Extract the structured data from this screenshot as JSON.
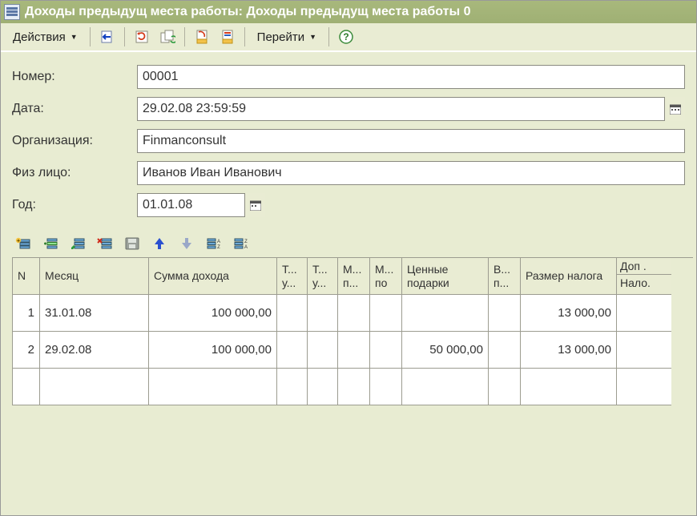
{
  "window": {
    "title": "Доходы предыдущ места работы: Доходы предыдущ места работы 0"
  },
  "toolbar": {
    "actions_label": "Действия",
    "goto_label": "Перейти"
  },
  "form": {
    "number_label": "Номер:",
    "number_value": "00001",
    "date_label": "Дата:",
    "date_value": "29.02.08 23:59:59",
    "org_label": "Организация:",
    "org_value": "Finmanconsult",
    "person_label": "Физ лицо:",
    "person_value": "Иванов Иван Иванович",
    "year_label": "Год:",
    "year_value": "01.01.08"
  },
  "grid": {
    "headers": {
      "n": "N",
      "month": "Месяц",
      "sum": "Сумма дохода",
      "h3": "Т... у...",
      "h4": "Т... у...",
      "h5": "М... п...",
      "h6": "М... по",
      "gifts": "Ценные подарки",
      "h8": "В... п...",
      "tax": "Размер налога",
      "extra_top": "Доп .",
      "extra_bot": "Нало."
    },
    "rows": [
      {
        "n": "1",
        "month": "31.01.08",
        "sum": "100 000,00",
        "c3": "",
        "c4": "",
        "c5": "",
        "c6": "",
        "gifts": "",
        "c8": "",
        "tax": "13 000,00"
      },
      {
        "n": "2",
        "month": "29.02.08",
        "sum": "100 000,00",
        "c3": "",
        "c4": "",
        "c5": "",
        "c6": "",
        "gifts": "50 000,00",
        "c8": "",
        "tax": "13 000,00"
      }
    ]
  }
}
